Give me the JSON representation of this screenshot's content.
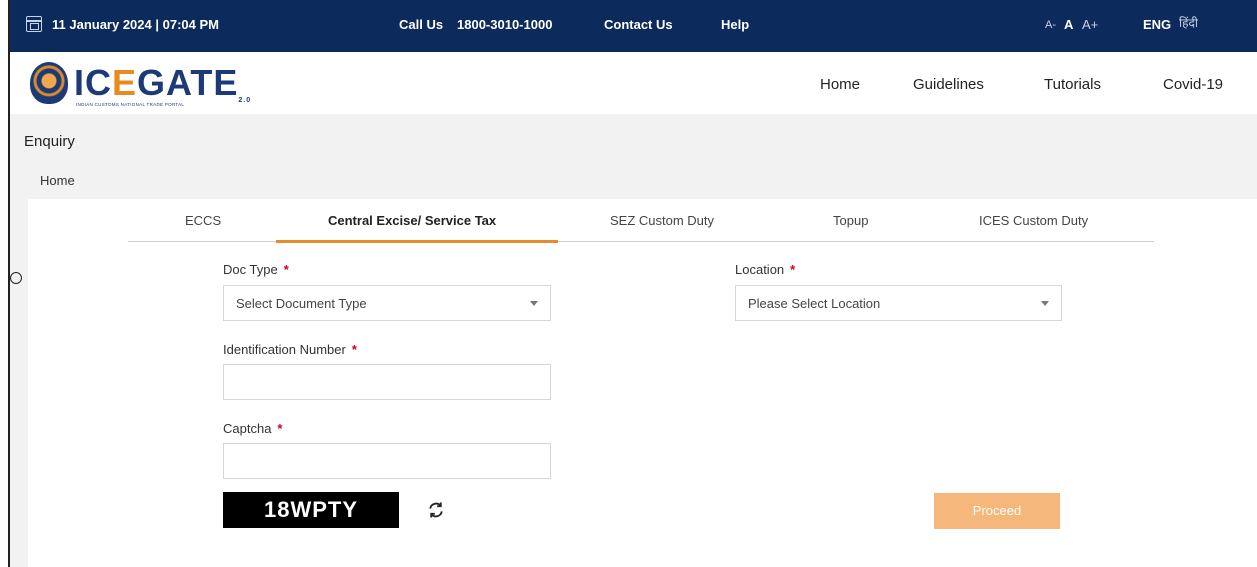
{
  "topbar": {
    "datetime": "11 January 2024 | 07:04 PM",
    "call_label": "Call Us",
    "call_number": "1800-3010-1000",
    "contact": "Contact Us",
    "help": "Help",
    "font_decrease": "A-",
    "font_normal": "A",
    "font_increase": "A+",
    "lang_eng": "ENG",
    "lang_hindi": "हिंदी"
  },
  "logo": {
    "text_a": "IC",
    "text_b": "E",
    "text_c": "GATE",
    "suffix": "2.0",
    "subtitle": "INDIAN CUSTOMS NATIONAL TRADE PORTAL"
  },
  "nav": {
    "items": [
      "Home",
      "Guidelines",
      "Tutorials",
      "Covid-19"
    ]
  },
  "page": {
    "title": "Enquiry",
    "breadcrumb": "Home"
  },
  "tabs": [
    "ECCS",
    "Central Excise/ Service Tax",
    "SEZ Custom Duty",
    "Topup",
    "ICES Custom Duty"
  ],
  "form": {
    "doc_type_label": "Doc Type",
    "doc_type_value": "Select Document Type",
    "location_label": "Location",
    "location_value": "Please Select Location",
    "id_label": "Identification Number",
    "id_value": "",
    "captcha_label": "Captcha",
    "captcha_value": "",
    "required_mark": "*",
    "captcha_code": "18WPTY",
    "proceed": "Proceed"
  },
  "colors": {
    "topbar": "#0d2a5c",
    "accent": "#e98a2c",
    "proceed_disabled": "#f6b77c",
    "required": "#d0021b"
  }
}
